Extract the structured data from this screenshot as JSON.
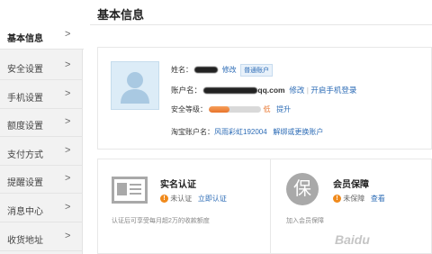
{
  "page_title": "基本信息",
  "sidebar": {
    "items": [
      {
        "label": "基本信息",
        "chevron": ">"
      },
      {
        "label": "安全设置",
        "chevron": ">"
      },
      {
        "label": "手机设置",
        "chevron": ">"
      },
      {
        "label": "额度设置",
        "chevron": ">"
      },
      {
        "label": "支付方式",
        "chevron": ">"
      },
      {
        "label": "提醒设置",
        "chevron": ">"
      },
      {
        "label": "消息中心",
        "chevron": ">"
      },
      {
        "label": "收货地址",
        "chevron": ">"
      }
    ]
  },
  "profile": {
    "name_label": "姓名：",
    "edit_name": "修改",
    "account_type": "普通账户",
    "account_label": "账户名：",
    "account_suffix": "qq.com",
    "edit_account": "修改",
    "account_sep": "|",
    "enable_phone_login": "开启手机登录",
    "security_label": "安全等级：",
    "security_level_text": "低",
    "security_level_fraction": 0.4,
    "upgrade": "提升",
    "taobao_label": "淘宝账户名：",
    "taobao_name": "风雨彩虹192004",
    "bind_taobao": "解绑或更换账户"
  },
  "verification": {
    "title": "实名认证",
    "status": "未认证",
    "action": "立即认证",
    "desc": "认证后可享受每月超2万的收款额度"
  },
  "protection": {
    "title": "会员保障",
    "icon_char": "保",
    "status": "未保障",
    "action": "查看",
    "desc": "加入会员保障"
  },
  "watermark": "Baidu"
}
